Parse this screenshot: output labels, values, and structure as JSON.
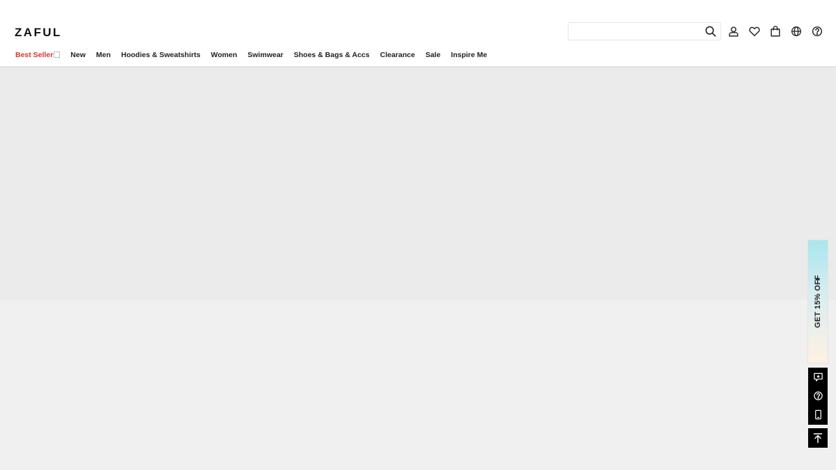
{
  "header": {
    "logo_text": "ZAFUL",
    "search": {
      "placeholder": "",
      "value": ""
    },
    "icons": [
      "search-icon",
      "user-icon",
      "heart-icon",
      "shopping-bag-icon",
      "globe-icon",
      "help-icon"
    ]
  },
  "nav": {
    "items": [
      {
        "label": "Best Seller",
        "highlight": true
      },
      {
        "label": "New"
      },
      {
        "label": "Men"
      },
      {
        "label": "Hoodies & Sweatshirts"
      },
      {
        "label": "Women"
      },
      {
        "label": "Swimwear"
      },
      {
        "label": "Shoes & Bags & Accs"
      },
      {
        "label": "Clearance"
      },
      {
        "label": "Sale"
      },
      {
        "label": "Inspire Me"
      }
    ]
  },
  "promo": {
    "label": "GET 15% OFF"
  },
  "side_tools": {
    "items": [
      "feedback-icon",
      "help-icon",
      "mobile-app-icon"
    ],
    "back_to_top_icon": "arrow-up-icon"
  },
  "colors": {
    "highlight_text": "#d9342b",
    "hero_bg": "#ebebeb",
    "page_bg": "#f0f0f0",
    "promo_gradient_top": "#a9e6ee",
    "promo_gradient_bottom": "#fff1e4",
    "tool_bg": "#000000"
  }
}
